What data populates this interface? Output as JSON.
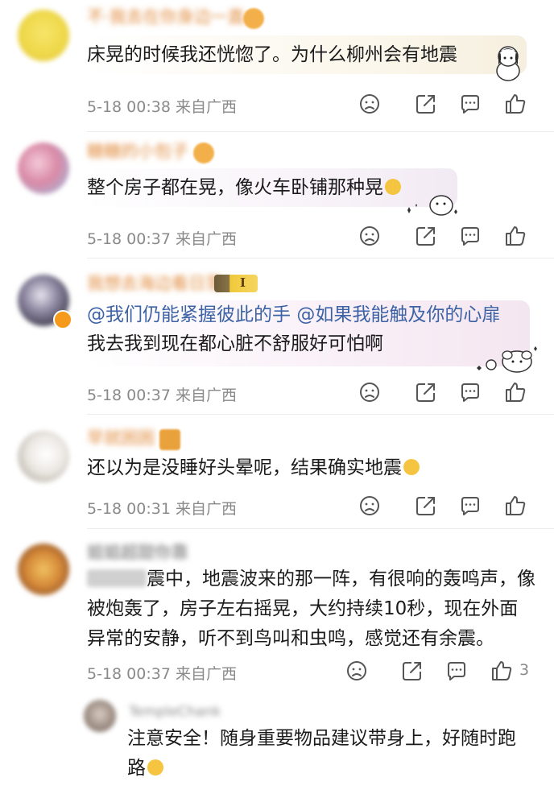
{
  "comments": [
    {
      "text": "床晃的时候我还恍惚了。为什么柳州会有地震",
      "date": "5-18 00:38",
      "location": "来自广西"
    },
    {
      "text": "整个房子都在晃，像火车卧铺那种晃",
      "date": "5-18 00:37",
      "location": "来自广西"
    },
    {
      "mention1": "@我们仍能紧握彼此的手",
      "mention2": "@如果我能触及你的心扉",
      "text": "我去我到现在都心脏不舒服好可怕啊",
      "level_badge": "I",
      "date": "5-18 00:37",
      "location": "来自广西"
    },
    {
      "text": "还以为是没睡好头晕呢，结果确实地震",
      "date": "5-18 00:31",
      "location": "来自广西"
    },
    {
      "text_line1": "震中，地震波来的那一阵，有很响的轰鸣声，像",
      "text_line2": "被炮轰了，房子左右摇晃，大约持续10秒，现在外面",
      "text_line3": "异常的安静，听不到鸟叫和虫鸣，感觉还有余震。",
      "date": "5-18 00:37",
      "location": "来自广西",
      "like_count": "3",
      "reply": {
        "text_line1": "注意安全！随身重要物品建议带身上，好随时跑",
        "text_line2": "路"
      }
    }
  ],
  "icons": {
    "dislike": "sad-face-icon",
    "share": "share-icon",
    "comment": "comment-icon",
    "like": "thumbs-up-icon"
  }
}
